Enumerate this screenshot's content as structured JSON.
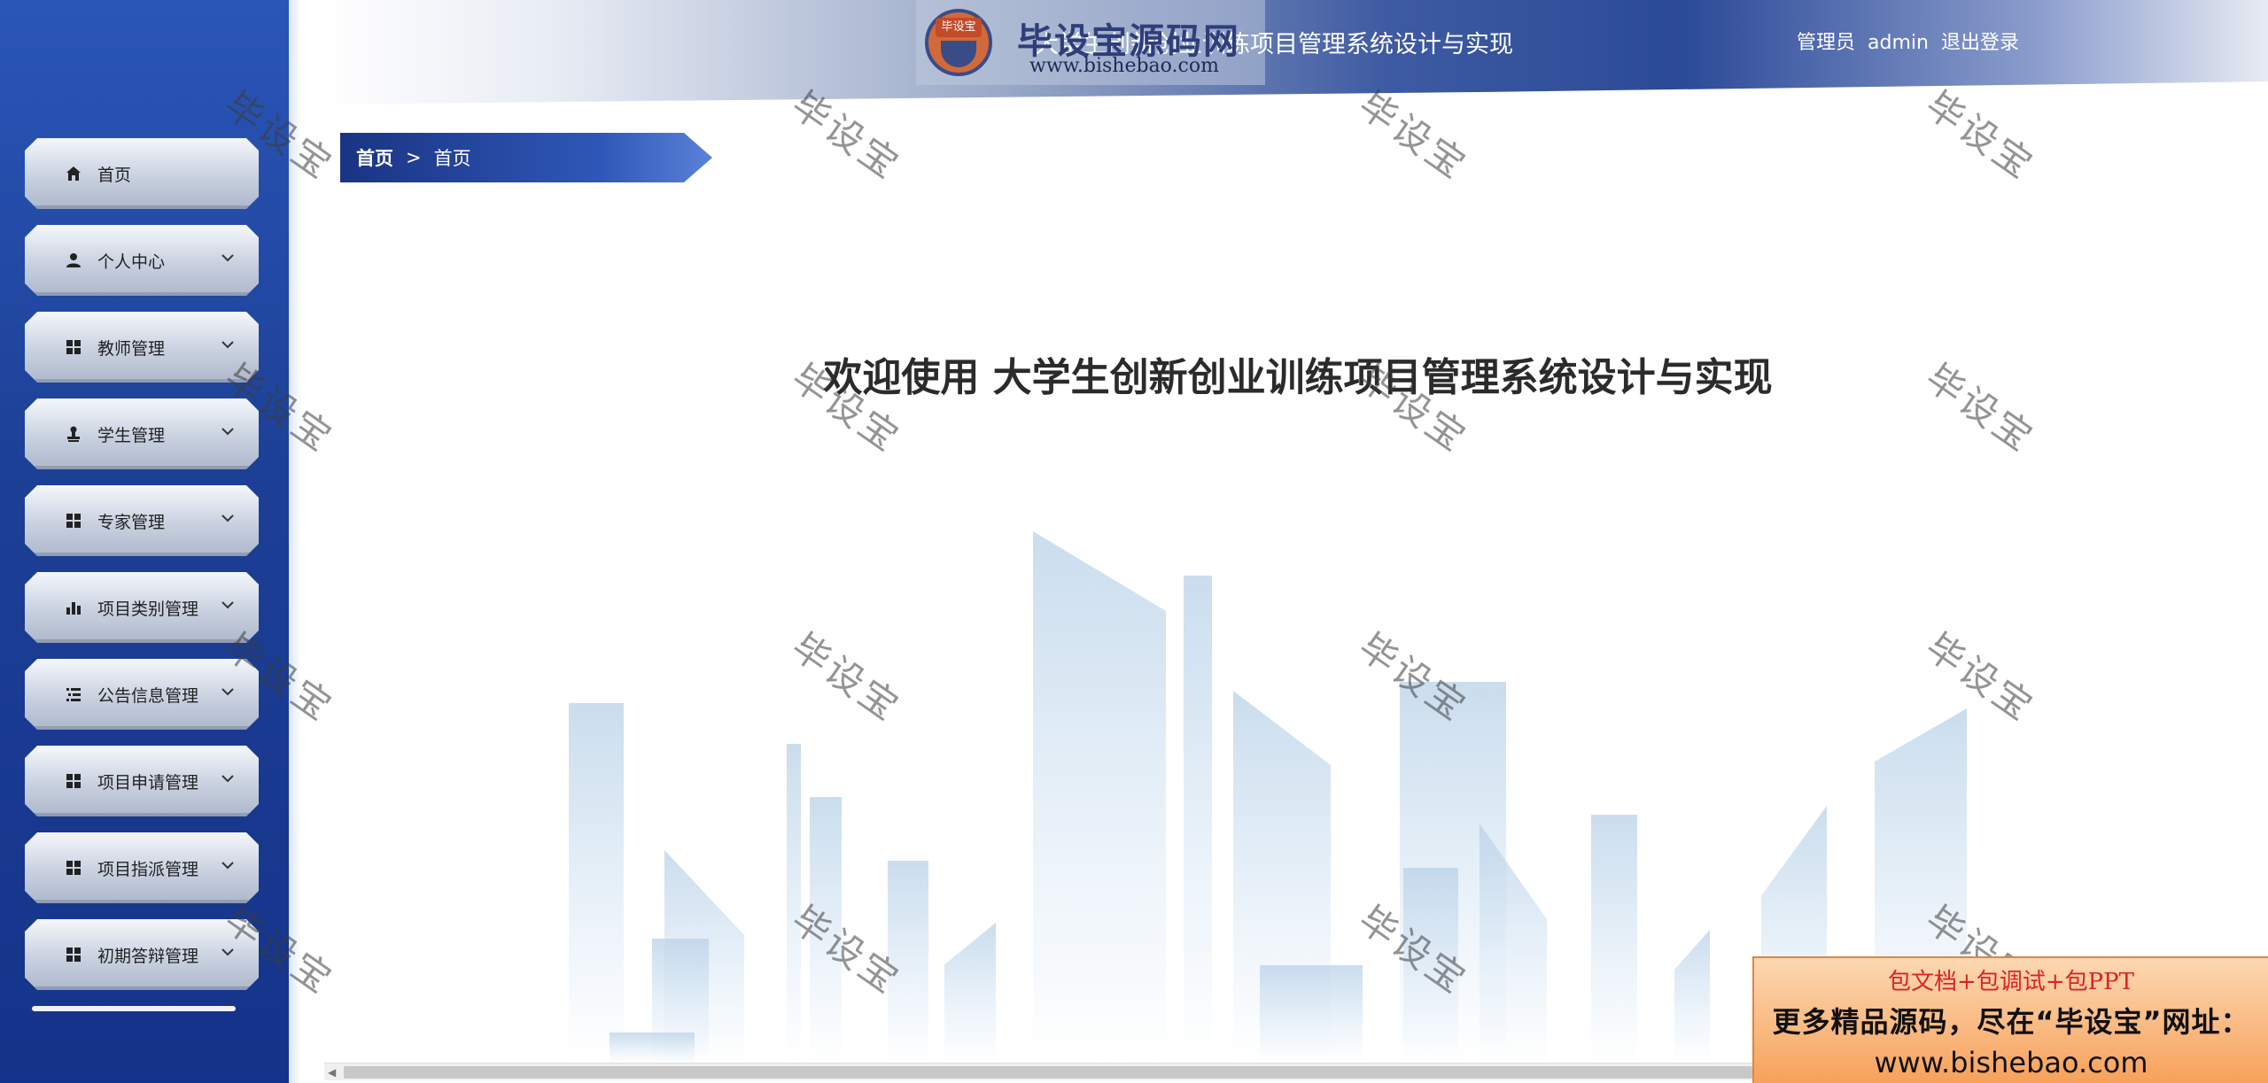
{
  "header": {
    "logo_badge": "毕设宝",
    "logo_title": "毕设宝源码网",
    "logo_url": "www.bishebao.com",
    "system_title": "大学生创新创业训练项目管理系统设计与实现",
    "user_role": "管理员",
    "user_name": "admin",
    "logout_label": "退出登录"
  },
  "sidebar": {
    "items": [
      {
        "label": "首页",
        "icon": "home-icon",
        "has_submenu": false
      },
      {
        "label": "个人中心",
        "icon": "person-icon",
        "has_submenu": true
      },
      {
        "label": "教师管理",
        "icon": "grid-icon",
        "has_submenu": true
      },
      {
        "label": "学生管理",
        "icon": "stamp-icon",
        "has_submenu": true
      },
      {
        "label": "专家管理",
        "icon": "grid-icon",
        "has_submenu": true
      },
      {
        "label": "项目类别管理",
        "icon": "bar-chart-icon",
        "has_submenu": true
      },
      {
        "label": "公告信息管理",
        "icon": "list-icon",
        "has_submenu": true
      },
      {
        "label": "项目申请管理",
        "icon": "grid-icon",
        "has_submenu": true
      },
      {
        "label": "项目指派管理",
        "icon": "grid-icon",
        "has_submenu": true
      },
      {
        "label": "初期答辩管理",
        "icon": "grid-icon",
        "has_submenu": true
      }
    ]
  },
  "breadcrumb": {
    "home": "首页",
    "separator": ">",
    "current": "首页"
  },
  "main": {
    "welcome_text": "欢迎使用 大学生创新创业训练项目管理系统设计与实现"
  },
  "watermark": "毕设宝",
  "promo": {
    "line1": "包文档+包调试+包PPT",
    "line2": "更多精品源码，尽在“毕设宝”网址：",
    "line3": "www.bishebao.com"
  },
  "colors": {
    "sidebar_bg": "#1c3f95",
    "header_accent": "#2b4a97",
    "breadcrumb_bg": "#2f57b8",
    "promo_bg": "#f7a15a"
  }
}
